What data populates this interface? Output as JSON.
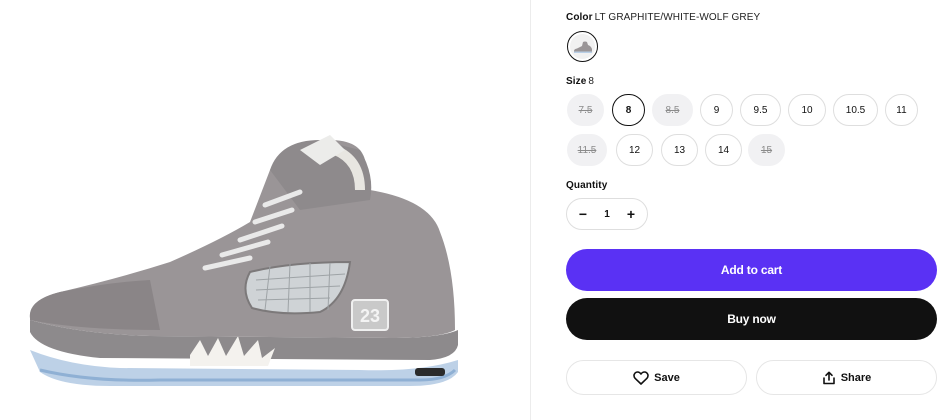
{
  "product": {
    "image_alt": "Air Jordan 5 Wolf Grey sneaker",
    "image_icon": "sneaker-image"
  },
  "color": {
    "label": "Color",
    "value": "LT GRAPHITE/WHITE-WOLF GREY"
  },
  "size": {
    "label": "Size",
    "selected": "8",
    "options": [
      {
        "label": "7.5",
        "available": false
      },
      {
        "label": "8",
        "available": true,
        "selected": true
      },
      {
        "label": "8.5",
        "available": false
      },
      {
        "label": "9",
        "available": true
      },
      {
        "label": "9.5",
        "available": true
      },
      {
        "label": "10",
        "available": true
      },
      {
        "label": "10.5",
        "available": true
      },
      {
        "label": "11",
        "available": true
      },
      {
        "label": "11.5",
        "available": false
      },
      {
        "label": "12",
        "available": true
      },
      {
        "label": "13",
        "available": true
      },
      {
        "label": "14",
        "available": true
      },
      {
        "label": "15",
        "available": false
      }
    ]
  },
  "quantity": {
    "label": "Quantity",
    "value": "1",
    "minus": "−",
    "plus": "+"
  },
  "actions": {
    "add_to_cart": "Add to cart",
    "buy_now": "Buy now",
    "save": "Save",
    "share": "Share"
  },
  "colors": {
    "accent": "#5a31f4",
    "buy": "#111111",
    "unavailable_bg": "#f1f1f3"
  }
}
